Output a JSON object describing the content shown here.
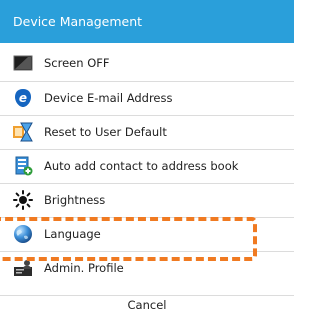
{
  "dialog": {
    "title": "Device Management",
    "items": [
      {
        "label": "Screen OFF",
        "icon": "screen-off-icon"
      },
      {
        "label": "Device E-mail Address",
        "icon": "email-icon"
      },
      {
        "label": "Reset to User Default",
        "icon": "reset-hourglass-icon"
      },
      {
        "label": "Auto add contact to address book",
        "icon": "address-book-icon"
      },
      {
        "label": "Brightness",
        "icon": "brightness-icon"
      },
      {
        "label": "Language",
        "icon": "globe-icon"
      },
      {
        "label": "Admin. Profile",
        "icon": "admin-profile-icon"
      }
    ],
    "cancel_label": "Cancel"
  },
  "colors": {
    "header": "#2a9fda",
    "highlight": "#f07a21"
  }
}
